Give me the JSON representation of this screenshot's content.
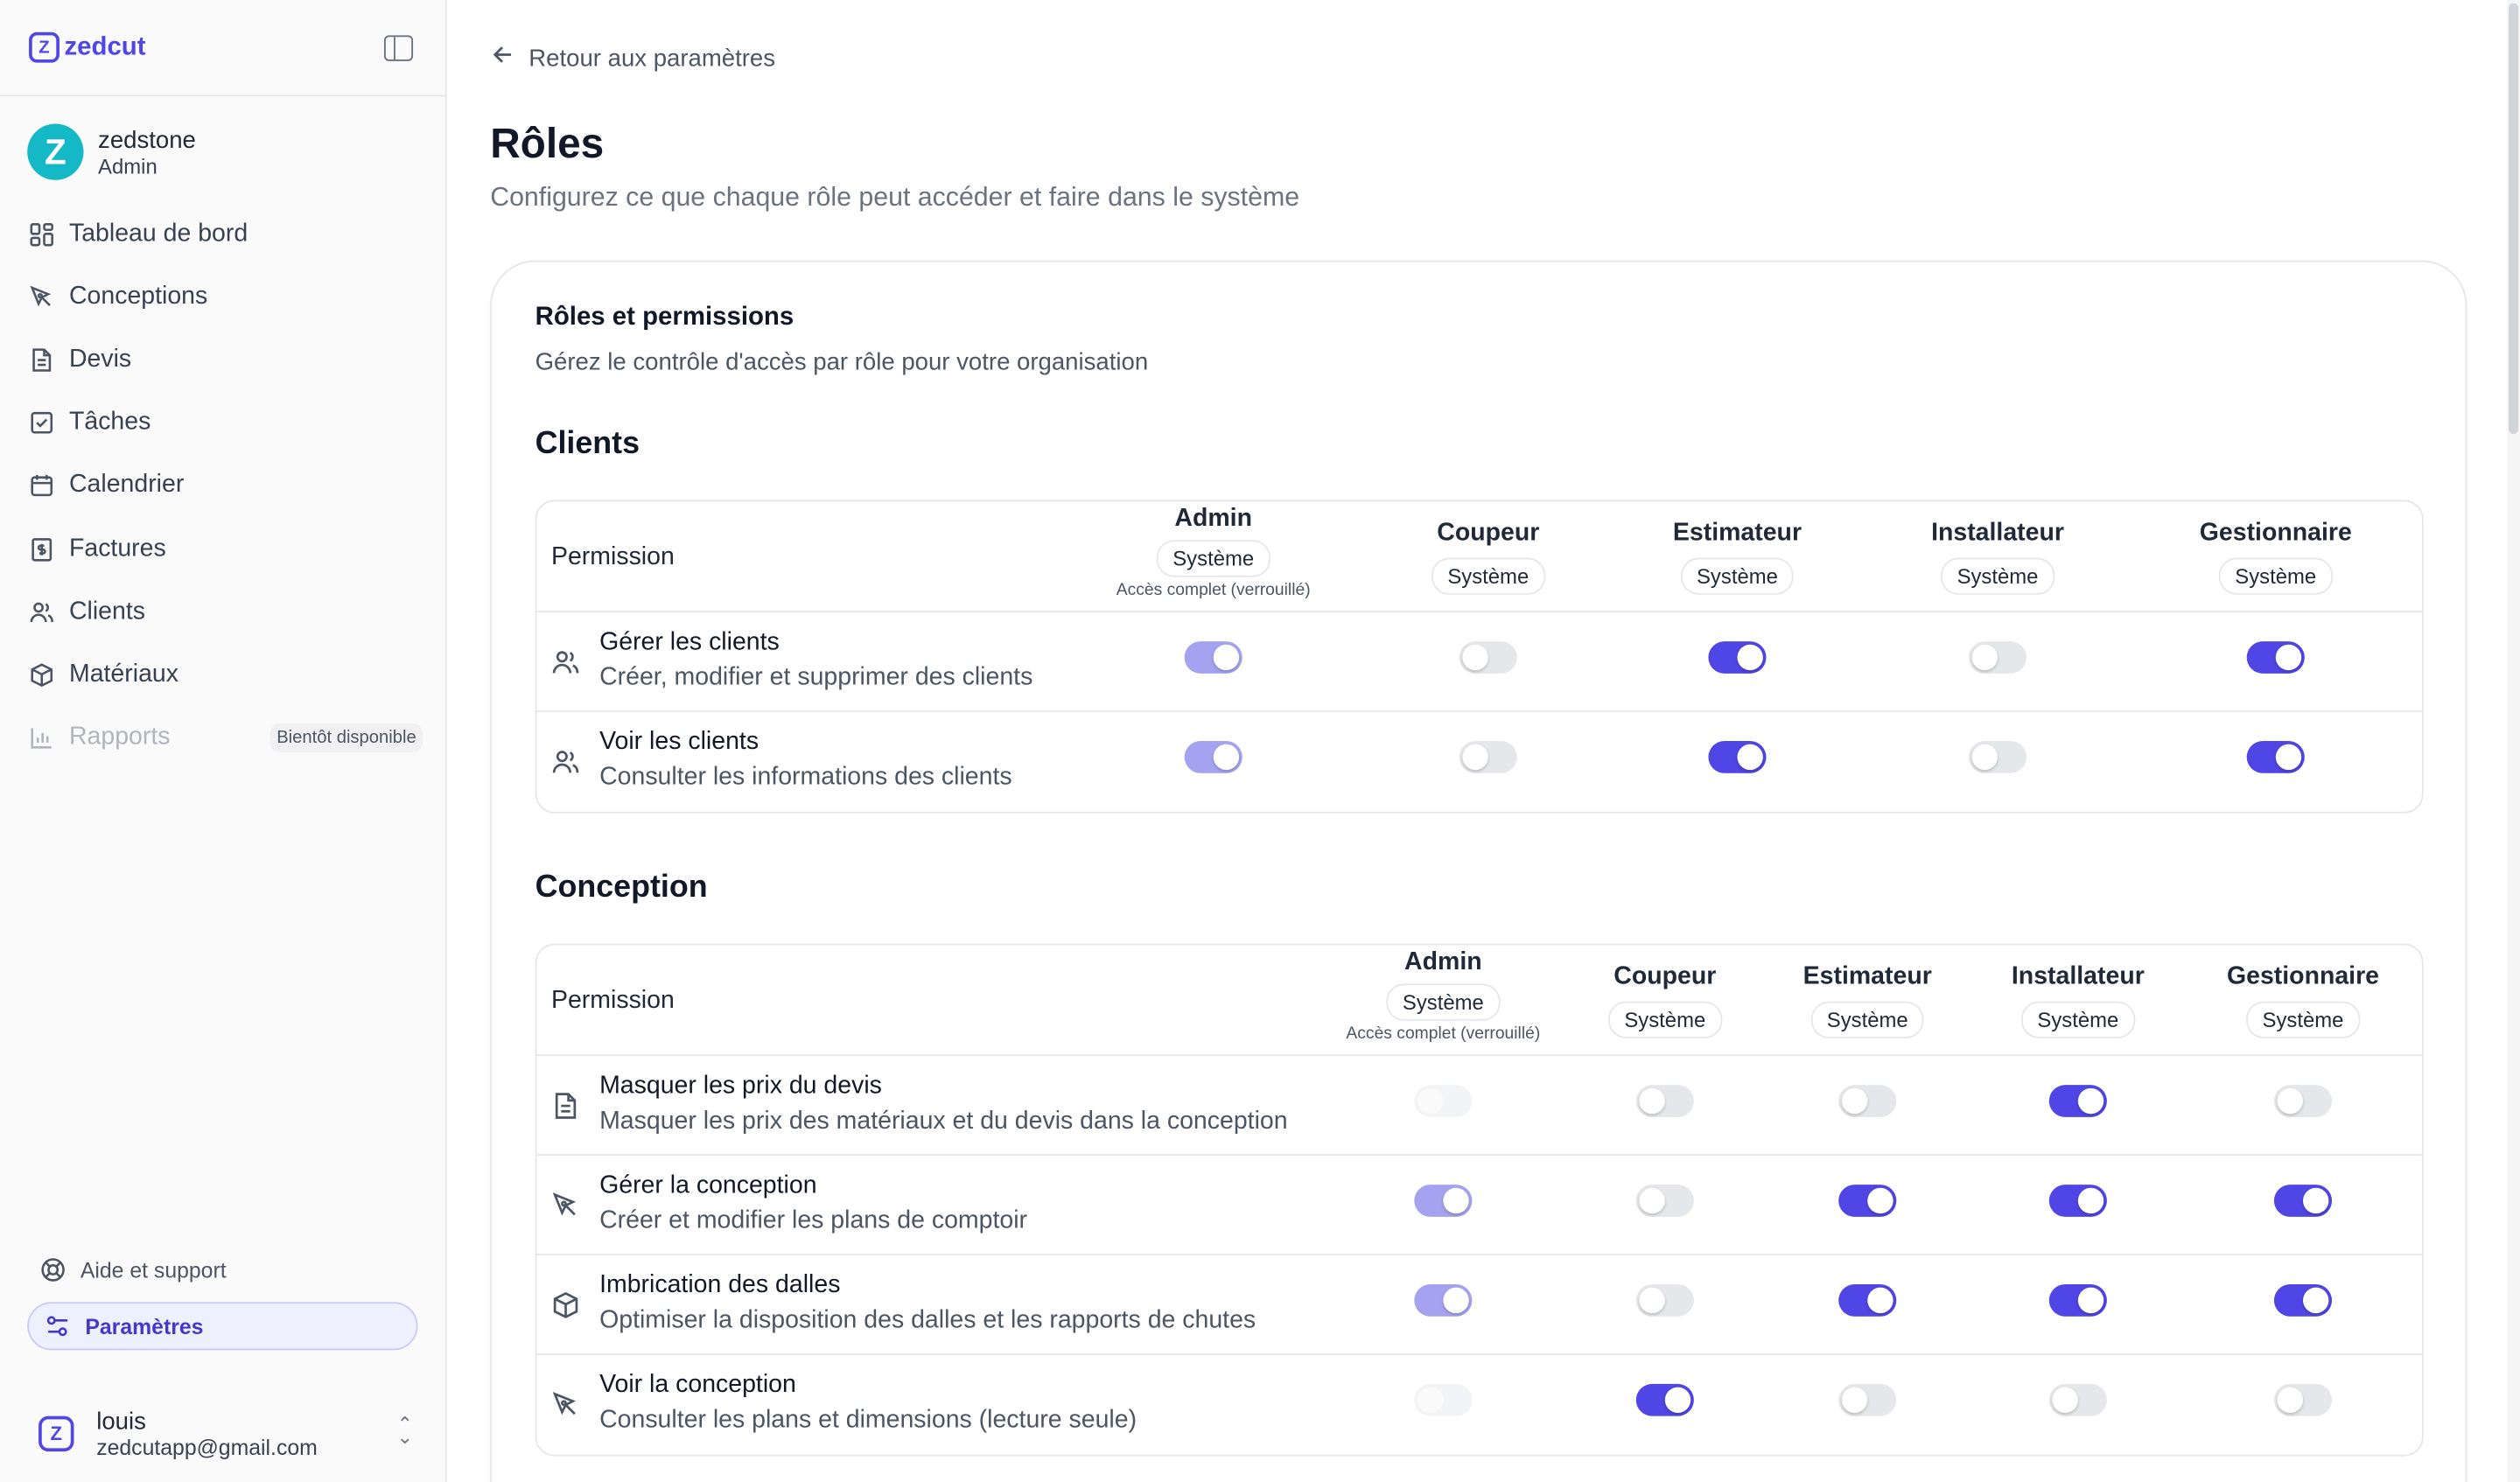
{
  "app": {
    "logo_text": "zedcut",
    "logo_mark": "Z"
  },
  "user_top": {
    "initial": "Z",
    "name": "zedstone",
    "role": "Admin"
  },
  "nav": {
    "items": [
      {
        "label": "Tableau de bord",
        "icon": "dashboard-icon"
      },
      {
        "label": "Conceptions",
        "icon": "pen-tool-icon"
      },
      {
        "label": "Devis",
        "icon": "document-icon"
      },
      {
        "label": "Tâches",
        "icon": "checkbox-icon"
      },
      {
        "label": "Calendrier",
        "icon": "calendar-icon"
      },
      {
        "label": "Factures",
        "icon": "invoice-icon"
      },
      {
        "label": "Clients",
        "icon": "users-icon"
      },
      {
        "label": "Matériaux",
        "icon": "box-icon"
      },
      {
        "label": "Rapports",
        "icon": "bar-chart-icon",
        "badge": "Bientôt disponible"
      }
    ],
    "help_label": "Aide et support",
    "settings_label": "Paramètres"
  },
  "user_bottom": {
    "initial": "Z",
    "name": "louis",
    "email": "zedcutapp@gmail.com"
  },
  "page": {
    "back_label": "Retour aux paramètres",
    "title": "Rôles",
    "subtitle": "Configurez ce que chaque rôle peut accéder et faire dans le système"
  },
  "card": {
    "title": "Rôles et permissions",
    "subtitle": "Gérez le contrôle d'accès par rôle pour votre organisation"
  },
  "table_header": {
    "permission_label": "Permission",
    "system_badge": "Système",
    "admin_note": "Accès complet (verrouillé)",
    "roles": [
      "Admin",
      "Coupeur",
      "Estimateur",
      "Installateur",
      "Gestionnaire"
    ]
  },
  "sections": [
    {
      "title": "Clients",
      "rows": [
        {
          "title": "Gérer les clients",
          "desc": "Créer, modifier et supprimer des clients",
          "icon": "users-icon",
          "toggles": [
            "locked-on",
            "off",
            "on",
            "off",
            "on"
          ]
        },
        {
          "title": "Voir les clients",
          "desc": "Consulter les informations des clients",
          "icon": "users-icon",
          "toggles": [
            "locked-on",
            "off",
            "on",
            "off",
            "on"
          ]
        }
      ]
    },
    {
      "title": "Conception",
      "rows": [
        {
          "title": "Masquer les prix du devis",
          "desc": "Masquer les prix des matériaux et du devis dans la conception",
          "icon": "document-icon",
          "toggles": [
            "locked-off",
            "off",
            "off",
            "on",
            "off"
          ]
        },
        {
          "title": "Gérer la conception",
          "desc": "Créer et modifier les plans de comptoir",
          "icon": "pen-tool-icon",
          "toggles": [
            "locked-on",
            "off",
            "on",
            "on",
            "on"
          ]
        },
        {
          "title": "Imbrication des dalles",
          "desc": "Optimiser la disposition des dalles et les rapports de chutes",
          "icon": "box-icon",
          "toggles": [
            "locked-on",
            "off",
            "on",
            "on",
            "on"
          ]
        },
        {
          "title": "Voir la conception",
          "desc": "Consulter les plans et dimensions (lecture seule)",
          "icon": "pen-tool-icon",
          "toggles": [
            "locked-off",
            "on",
            "off",
            "off",
            "off"
          ]
        }
      ]
    }
  ],
  "colors": {
    "accent": "#4f46e5",
    "accent_locked": "#a5a3ef",
    "toggle_off": "#e5e7eb"
  }
}
